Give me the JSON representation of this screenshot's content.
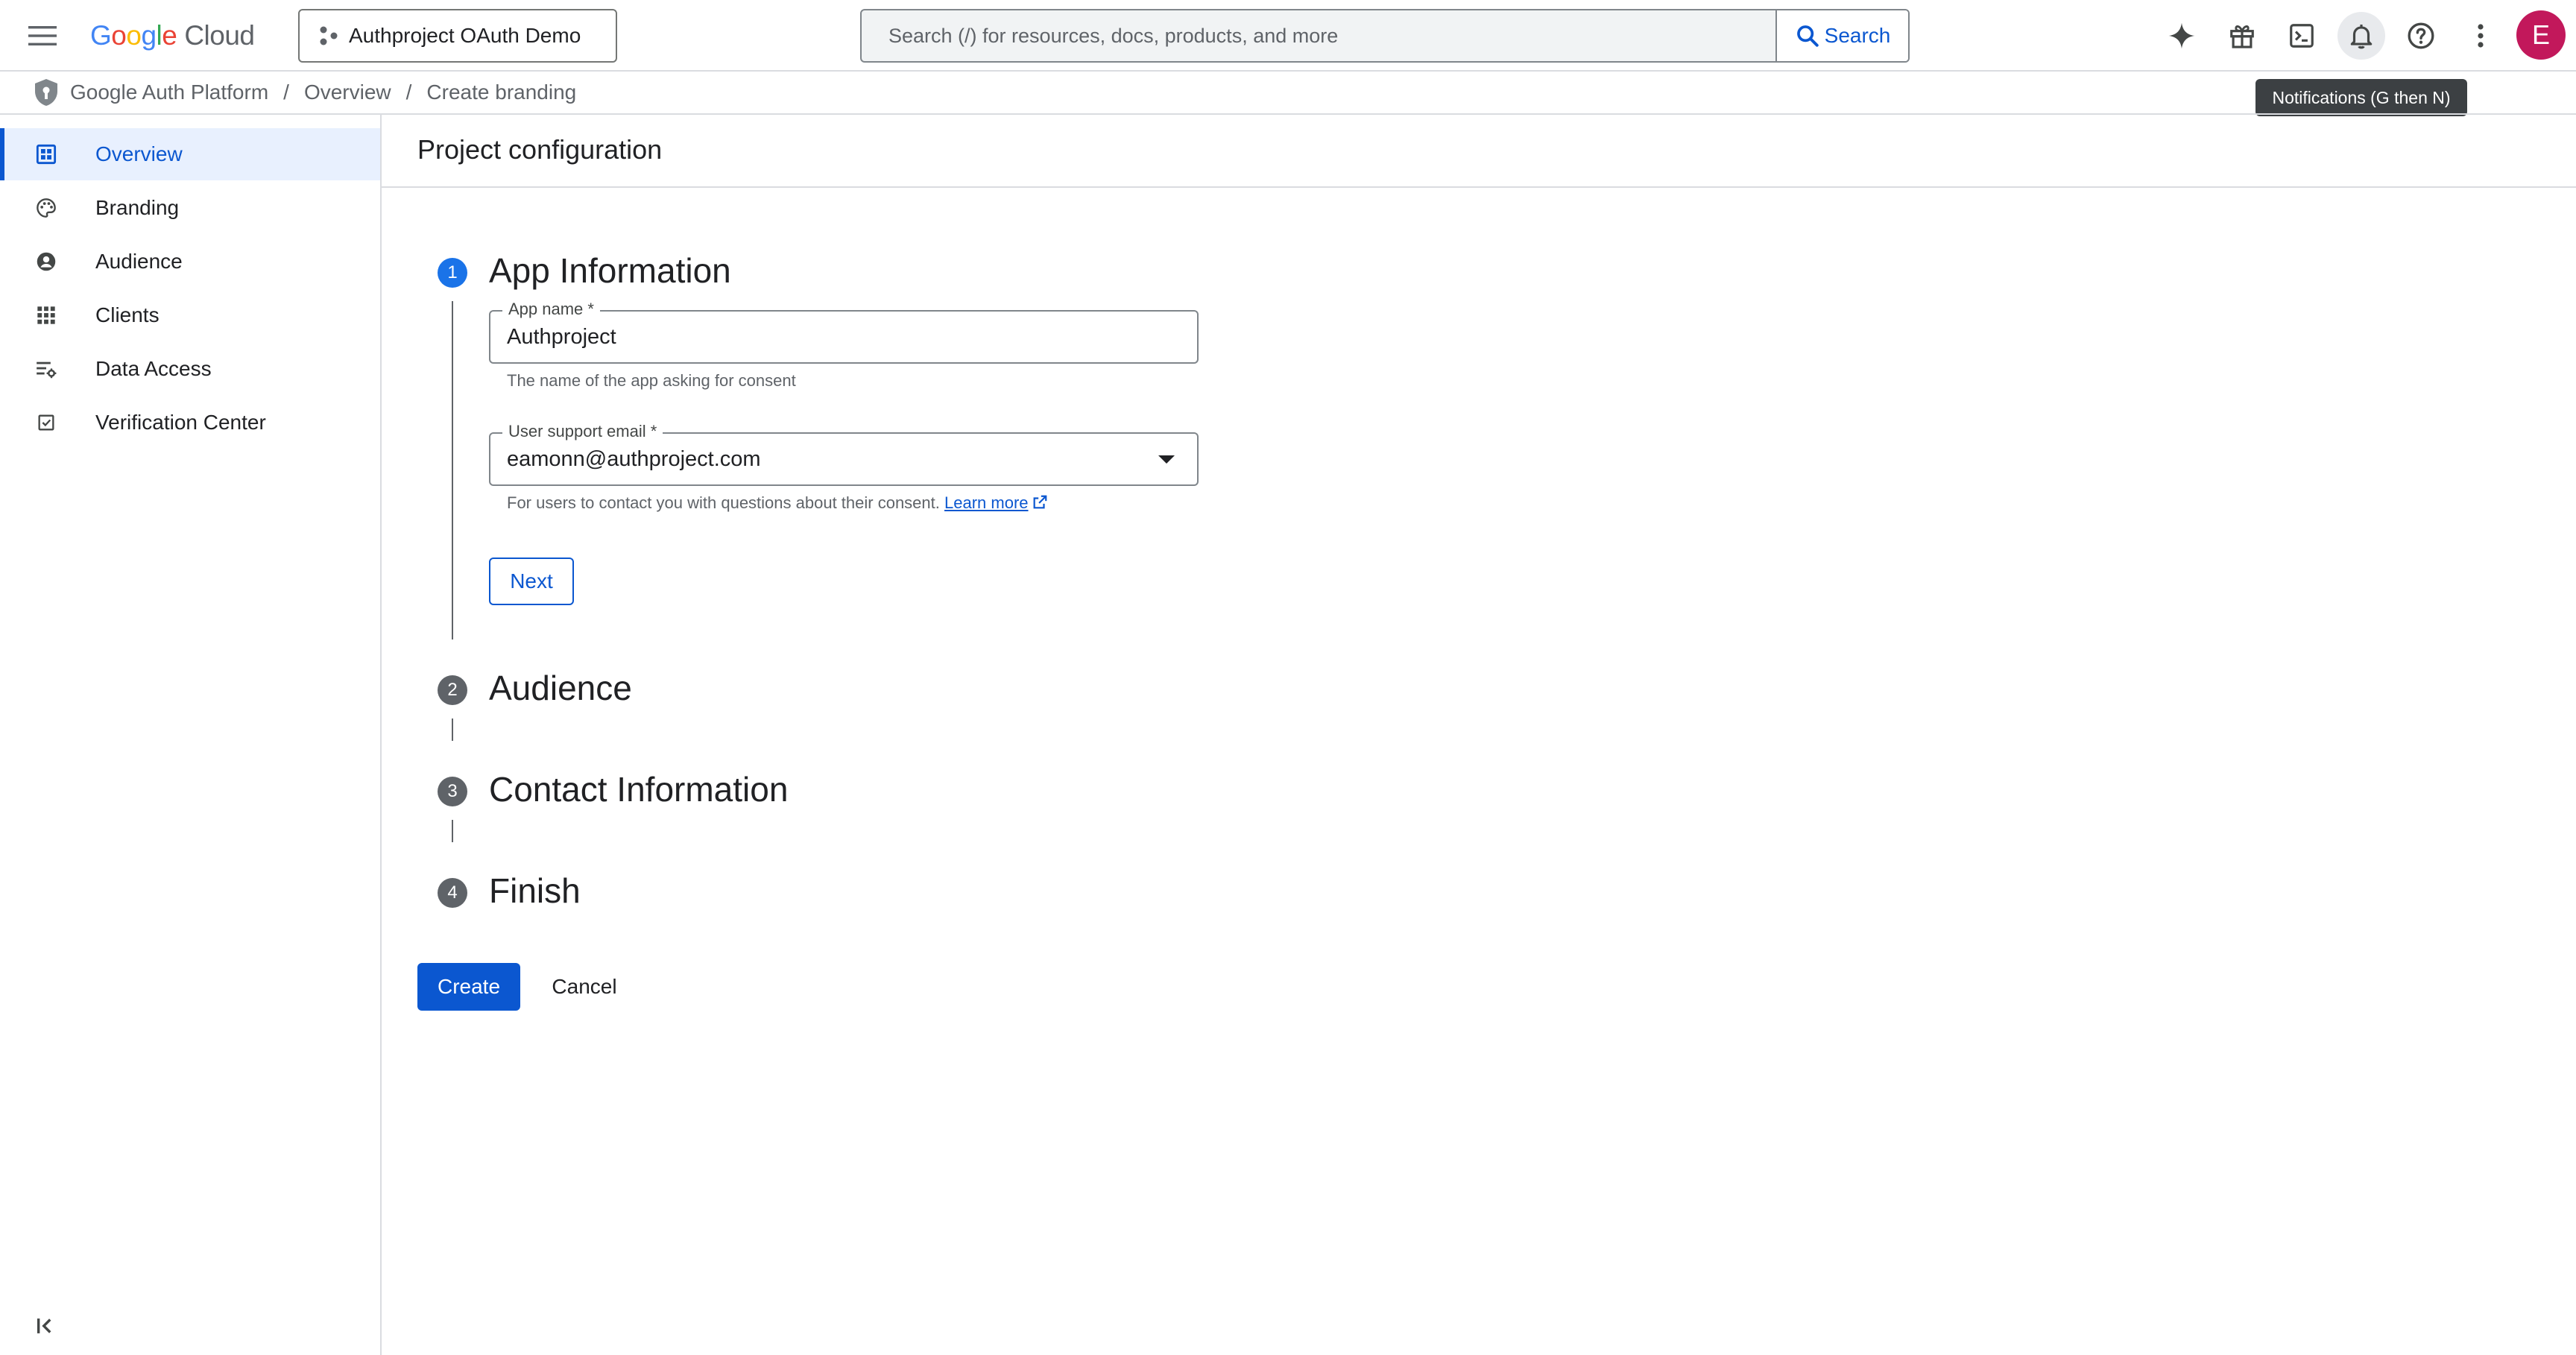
{
  "topbar": {
    "logo": {
      "g1": "G",
      "o1": "o",
      "o2": "o",
      "g2": "g",
      "l": "l",
      "e": "e",
      "product": "Cloud"
    },
    "project_picker": "Authproject OAuth Demo",
    "search_placeholder": "Search (/) for resources, docs, products, and more",
    "search_button": "Search",
    "icons": [
      "gemini-icon",
      "gift-icon",
      "cloud-shell-icon",
      "notifications-icon",
      "help-icon",
      "more-vert-icon"
    ],
    "avatar_letter": "E",
    "avatar_color": "#c2185b",
    "tooltip": "Notifications (G then N)"
  },
  "breadcrumb": [
    "Google Auth Platform",
    "Overview",
    "Create branding"
  ],
  "sidebar": {
    "items": [
      {
        "label": "Overview",
        "icon": "dashboard-icon",
        "active": true
      },
      {
        "label": "Branding",
        "icon": "palette-icon",
        "active": false
      },
      {
        "label": "Audience",
        "icon": "account-circle-icon",
        "active": false
      },
      {
        "label": "Clients",
        "icon": "apps-grid-icon",
        "active": false
      },
      {
        "label": "Data Access",
        "icon": "data-settings-icon",
        "active": false
      },
      {
        "label": "Verification Center",
        "icon": "verified-checkbox-icon",
        "active": false
      }
    ],
    "collapse_icon": "collapse-sidebar-icon"
  },
  "main": {
    "title": "Project configuration",
    "steps": [
      {
        "number": "1",
        "title": "App Information",
        "state": "active"
      },
      {
        "number": "2",
        "title": "Audience",
        "state": "pending"
      },
      {
        "number": "3",
        "title": "Contact Information",
        "state": "pending"
      },
      {
        "number": "4",
        "title": "Finish",
        "state": "pending"
      }
    ],
    "app_name": {
      "label": "App name *",
      "value": "Authproject",
      "hint": "The name of the app asking for consent"
    },
    "support_email": {
      "label": "User support email *",
      "value": "eamonn@authproject.com",
      "hint": "For users to contact you with questions about their consent.",
      "link": "Learn more"
    },
    "next_button": "Next",
    "create_button": "Create",
    "cancel_button": "Cancel"
  },
  "colors": {
    "accent": "#0b57d0",
    "active_step": "#1a73e8",
    "nav_active_bg": "#e8f0fe"
  }
}
